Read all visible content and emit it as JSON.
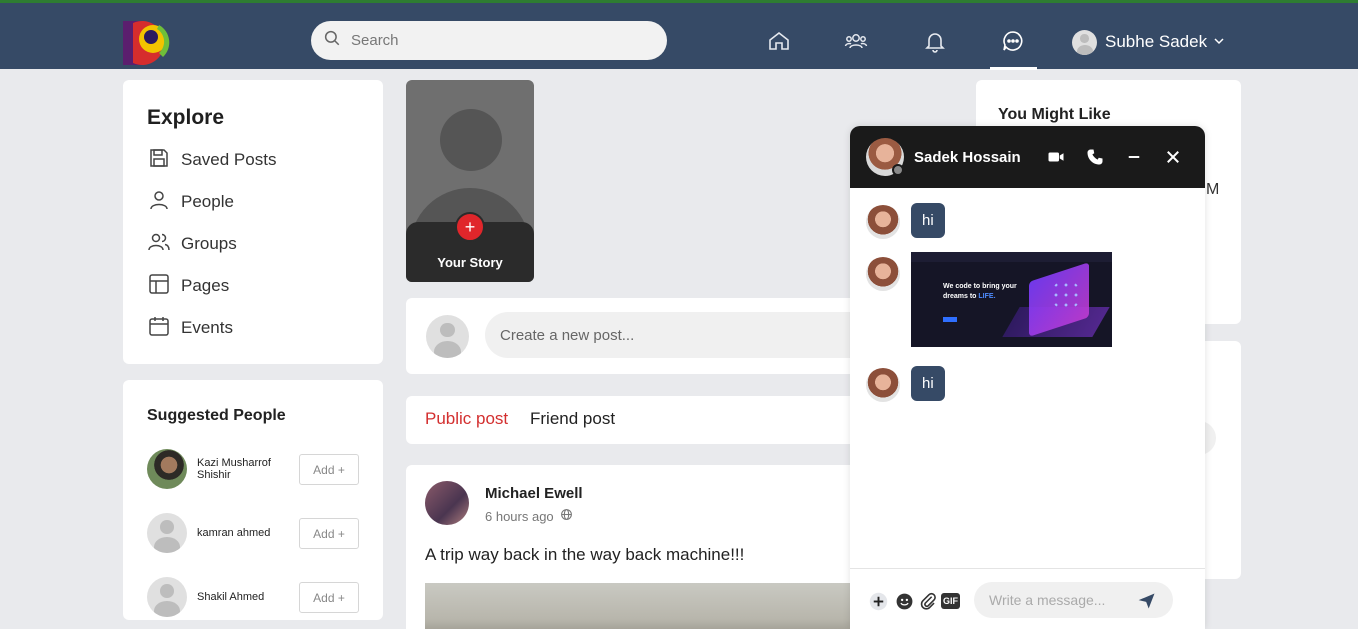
{
  "header": {
    "search_placeholder": "Search",
    "user_name": "Subhe Sadek",
    "nav_icons": [
      "home-icon",
      "groups-icon",
      "bell-icon",
      "messenger-icon"
    ],
    "accent": "#364a66"
  },
  "explore": {
    "title": "Explore",
    "items": [
      {
        "label": "Saved Posts",
        "icon": "save-icon"
      },
      {
        "label": "People",
        "icon": "person-icon"
      },
      {
        "label": "Groups",
        "icon": "groups-icon"
      },
      {
        "label": "Pages",
        "icon": "page-layout-icon"
      },
      {
        "label": "Events",
        "icon": "calendar-icon"
      }
    ]
  },
  "suggested": {
    "title": "Suggested People",
    "people": [
      {
        "name": "Kazi Musharrof Shishir",
        "action": "Add +"
      },
      {
        "name": "kamran ahmed",
        "action": "Add +"
      },
      {
        "name": "Shakil Ahmed",
        "action": "Add +"
      }
    ]
  },
  "story": {
    "label": "Your Story",
    "plus": "+"
  },
  "create_post": {
    "placeholder": "Create a new post..."
  },
  "post_tabs": {
    "public": "Public post",
    "friend": "Friend post"
  },
  "post": {
    "author": "Michael Ewell",
    "time": "6 hours ago",
    "text": "A trip way back in the way back machine!!!"
  },
  "right": {
    "might_like_title": "You Might Like",
    "peek_text": "M"
  },
  "chat": {
    "name": "Sadek Hossain",
    "messages": [
      {
        "type": "text",
        "text": "hi"
      },
      {
        "type": "image",
        "headline_a": "We code to bring your",
        "headline_b": "dreams to ",
        "headline_c": "LIFE."
      },
      {
        "type": "text",
        "text": "hi"
      }
    ],
    "input_placeholder": "Write a message...",
    "gif_label": "GIF"
  }
}
